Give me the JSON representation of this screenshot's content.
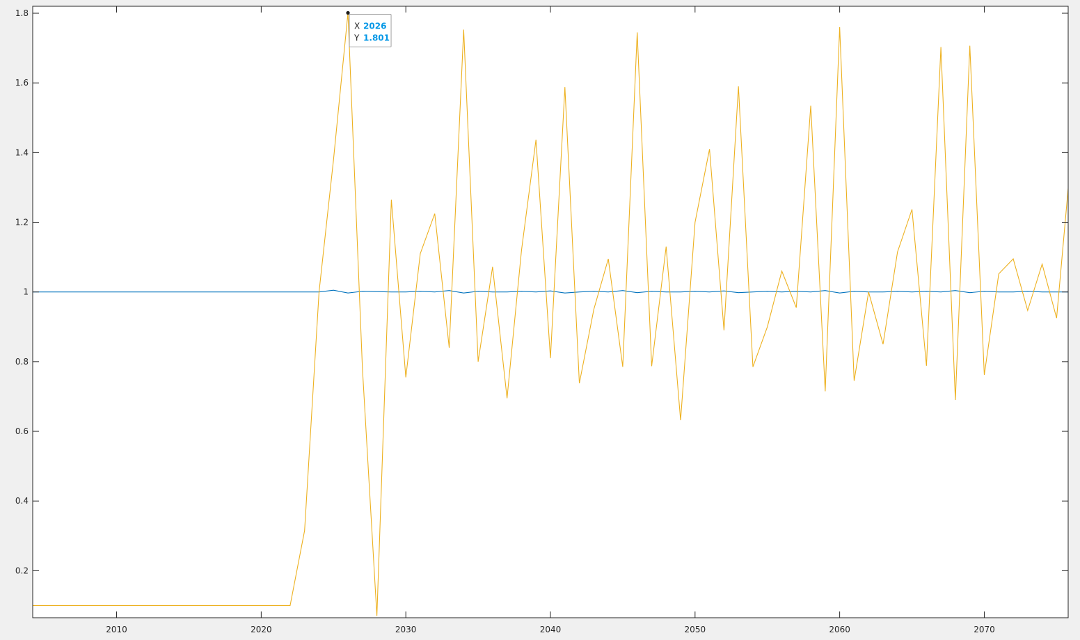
{
  "chart_data": {
    "type": "line",
    "title": "",
    "xlabel": "",
    "ylabel": "",
    "xlim": [
      2004.2,
      2075.8
    ],
    "ylim": [
      0.065,
      1.82
    ],
    "xticks": [
      2010,
      2020,
      2030,
      2040,
      2050,
      2060,
      2070
    ],
    "yticks": [
      0.2,
      0.4,
      0.6,
      0.8,
      1,
      1.2,
      1.4,
      1.6,
      1.8
    ],
    "xtick_labels": [
      "2010",
      "2020",
      "2030",
      "2040",
      "2050",
      "2060",
      "2070"
    ],
    "ytick_labels": [
      "0.2",
      "0.4",
      "0.6",
      "0.8",
      "1",
      "1.2",
      "1.4",
      "1.6",
      "1.8"
    ],
    "grid": false,
    "box": true,
    "series": [
      {
        "color": "#0072bd",
        "x": [
          2004,
          2005,
          2006,
          2007,
          2008,
          2009,
          2010,
          2011,
          2012,
          2013,
          2014,
          2015,
          2016,
          2017,
          2018,
          2019,
          2020,
          2021,
          2022,
          2023,
          2024,
          2025,
          2026,
          2027,
          2028,
          2029,
          2030,
          2031,
          2032,
          2033,
          2034,
          2035,
          2036,
          2037,
          2038,
          2039,
          2040,
          2041,
          2042,
          2043,
          2044,
          2045,
          2046,
          2047,
          2048,
          2049,
          2050,
          2051,
          2052,
          2053,
          2054,
          2055,
          2056,
          2057,
          2058,
          2059,
          2060,
          2061,
          2062,
          2063,
          2064,
          2065,
          2066,
          2067,
          2068,
          2069,
          2070,
          2071,
          2072,
          2073,
          2074,
          2075,
          2076
        ],
        "y": [
          1.0,
          1.0,
          1.0,
          1.0,
          1.0,
          1.0,
          1.0,
          1.0,
          1.0,
          1.0,
          1.0,
          1.0,
          1.0,
          1.0,
          1.0,
          1.0,
          1.0,
          1.0,
          1.0,
          1.0,
          1.0,
          1.005,
          0.997,
          1.002,
          1.001,
          1.0,
          1.0,
          1.002,
          1.0,
          1.004,
          0.997,
          1.002,
          1.0,
          1.0,
          1.002,
          1.0,
          1.003,
          0.997,
          1.0,
          1.002,
          1.0,
          1.004,
          0.998,
          1.002,
          1.0,
          1.0,
          1.002,
          1.0,
          1.003,
          0.998,
          1.0,
          1.002,
          1.0,
          1.002,
          1.0,
          1.004,
          0.997,
          1.002,
          1.0,
          1.0,
          1.002,
          1.0,
          1.002,
          1.0,
          1.004,
          0.998,
          1.002,
          1.0,
          1.0,
          1.002,
          1.0,
          1.0,
          1.0
        ]
      },
      {
        "color": "#edb120",
        "x": [
          2004,
          2005,
          2006,
          2007,
          2008,
          2009,
          2010,
          2011,
          2012,
          2013,
          2014,
          2015,
          2016,
          2017,
          2018,
          2019,
          2020,
          2021,
          2022,
          2023,
          2024,
          2025,
          2026,
          2027,
          2028,
          2029,
          2030,
          2031,
          2032,
          2033,
          2034,
          2035,
          2036,
          2037,
          2038,
          2039,
          2040,
          2041,
          2042,
          2043,
          2044,
          2045,
          2046,
          2047,
          2048,
          2049,
          2050,
          2051,
          2052,
          2053,
          2054,
          2055,
          2056,
          2057,
          2058,
          2059,
          2060,
          2061,
          2062,
          2063,
          2064,
          2065,
          2066,
          2067,
          2068,
          2069,
          2070,
          2071,
          2072,
          2073,
          2074,
          2075,
          2076
        ],
        "y": [
          0.1,
          0.1,
          0.1,
          0.1,
          0.1,
          0.1,
          0.1,
          0.1,
          0.1,
          0.1,
          0.1,
          0.1,
          0.1,
          0.1,
          0.1,
          0.1,
          0.1,
          0.1,
          0.1,
          0.315,
          1.0,
          1.38,
          1.801,
          0.78,
          0.07,
          1.265,
          0.755,
          1.11,
          1.225,
          0.84,
          1.753,
          0.8,
          1.072,
          0.695,
          1.12,
          1.437,
          0.81,
          1.588,
          0.738,
          0.95,
          1.095,
          0.785,
          1.745,
          0.787,
          1.13,
          0.632,
          1.2,
          1.41,
          0.89,
          1.59,
          0.785,
          0.9,
          1.06,
          0.955,
          1.535,
          0.715,
          1.76,
          0.745,
          1.0,
          0.85,
          1.115,
          1.237,
          0.788,
          1.703,
          0.69,
          1.707,
          0.762,
          1.052,
          1.095,
          0.947,
          1.08,
          0.925,
          1.39
        ]
      }
    ],
    "datatip": {
      "x_key": "X",
      "y_key": "Y",
      "x_value": "2026",
      "y_value": "1.801",
      "point": [
        2026,
        1.801
      ]
    }
  }
}
